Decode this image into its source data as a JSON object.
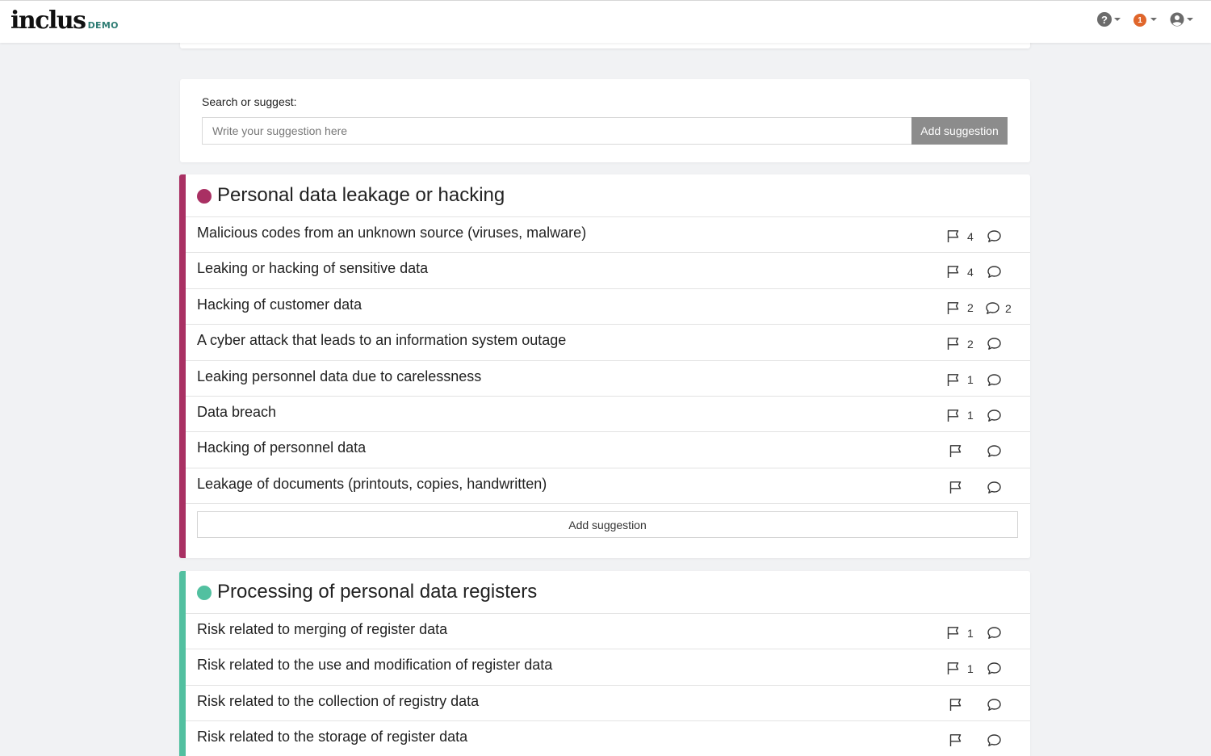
{
  "brand": {
    "name": "inclus",
    "tag": "DEMO"
  },
  "nav": {
    "help_glyph": "?",
    "notifications_count": "1"
  },
  "search": {
    "label": "Search or suggest:",
    "placeholder": "Write your suggestion here",
    "button_label": "Add suggestion"
  },
  "categories": [
    {
      "title": "Personal data leakage or hacking",
      "color": "#a93063",
      "add_label": "Add suggestion",
      "risks": [
        {
          "title": "Malicious codes from an unknown source (viruses, malware)",
          "flags": "4",
          "comments": ""
        },
        {
          "title": "Leaking or hacking of sensitive data",
          "flags": "4",
          "comments": ""
        },
        {
          "title": "Hacking of customer data",
          "flags": "2",
          "comments": "2"
        },
        {
          "title": "A cyber attack that leads to an information system outage",
          "flags": "2",
          "comments": ""
        },
        {
          "title": "Leaking personnel data due to carelessness",
          "flags": "1",
          "comments": ""
        },
        {
          "title": "Data breach",
          "flags": "1",
          "comments": ""
        },
        {
          "title": "Hacking of personnel data",
          "flags": "",
          "comments": ""
        },
        {
          "title": "Leakage of documents (printouts, copies, handwritten)",
          "flags": "",
          "comments": ""
        }
      ]
    },
    {
      "title": "Processing of personal data registers",
      "color": "#52c0a0",
      "risks": [
        {
          "title": "Risk related to merging of register data",
          "flags": "1",
          "comments": ""
        },
        {
          "title": "Risk related to the use and modification of register data",
          "flags": "1",
          "comments": ""
        },
        {
          "title": "Risk related to the collection of registry data",
          "flags": "",
          "comments": ""
        },
        {
          "title": "Risk related to the storage of register data",
          "flags": "",
          "comments": ""
        }
      ]
    }
  ]
}
